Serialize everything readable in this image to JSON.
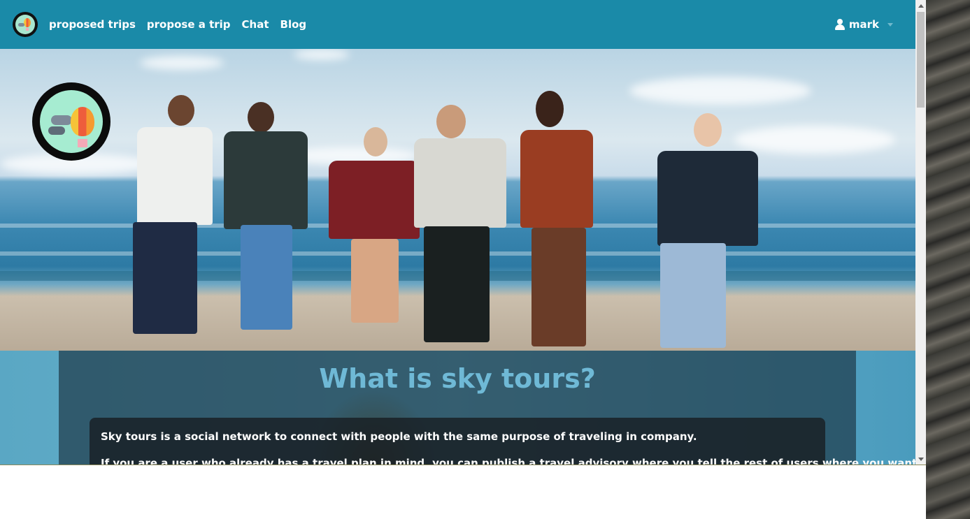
{
  "navbar": {
    "links": [
      "proposed trips",
      "propose a trip",
      "Chat",
      "Blog"
    ],
    "user": "mark",
    "logo_icon": "hot-air-balloon-logo",
    "background_color": "#1a8aa8"
  },
  "hero": {
    "image_description_icon": "group-of-friends-on-beach-photo",
    "logo_icon": "hot-air-balloon-logo"
  },
  "about": {
    "title": "What is sky tours?",
    "paragraphs": [
      "Sky tours is a social network to connect with people with the same purpose of traveling in company.",
      "If you are a user who already has a travel plan in mind, you can publish a travel advisory where you tell the rest of users where you want"
    ],
    "title_color": "#6fb9d6"
  }
}
